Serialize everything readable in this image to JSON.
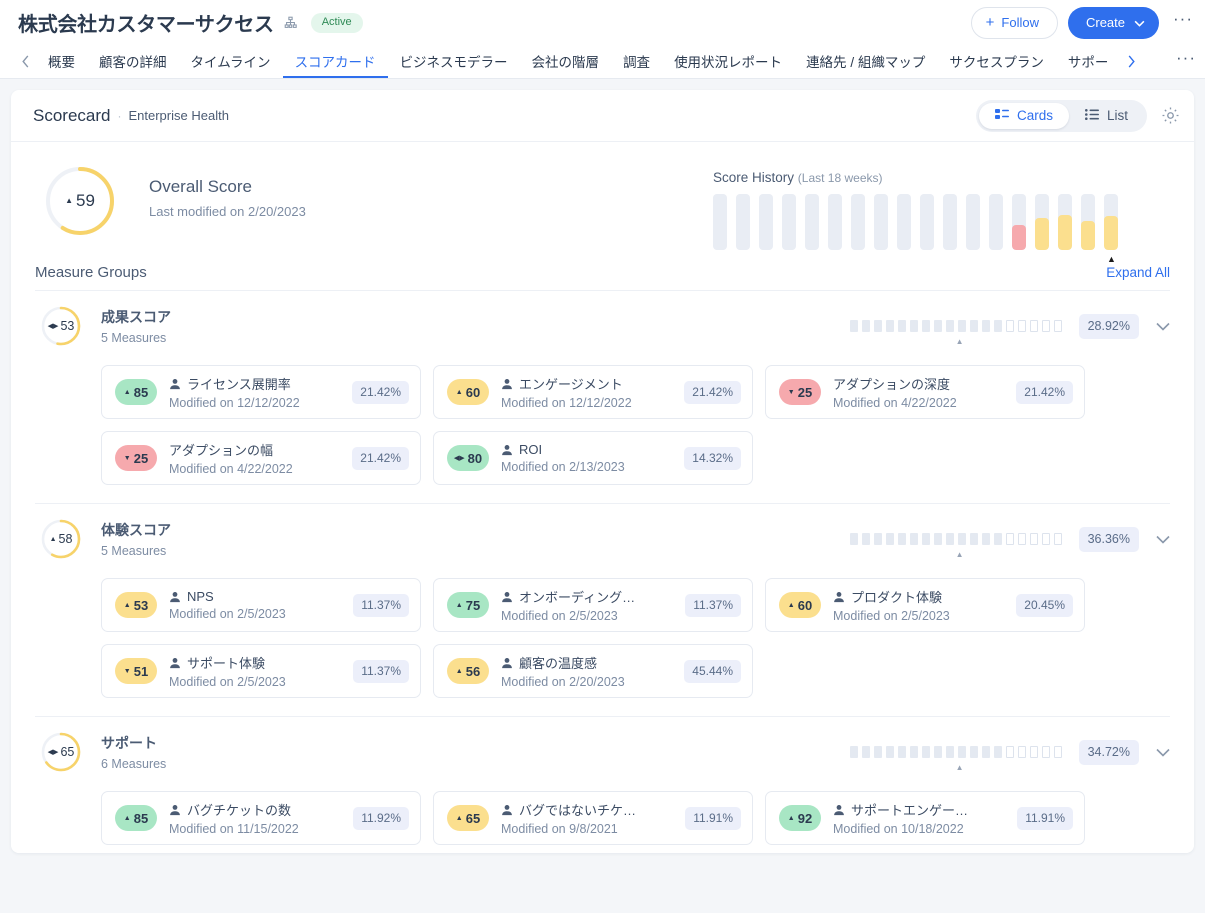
{
  "header": {
    "company_title": "株式会社カスタマーサクセス",
    "hierarchy_icon": "org-hierarchy-icon",
    "status": "Active",
    "follow_label": "Follow",
    "follow_icon": "plus-icon",
    "create_label": "Create",
    "create_icon": "chevron-down-icon",
    "overflow_icon": "ellipsis-icon"
  },
  "tabs": {
    "prev_icon": "chevron-left-icon",
    "next_icon": "chevron-right-icon",
    "more_icon": "ellipsis-icon",
    "items": [
      {
        "label": "概要",
        "active": false
      },
      {
        "label": "顧客の詳細",
        "active": false
      },
      {
        "label": "タイムライン",
        "active": false
      },
      {
        "label": "スコアカード",
        "active": true
      },
      {
        "label": "ビジネスモデラー",
        "active": false
      },
      {
        "label": "会社の階層",
        "active": false
      },
      {
        "label": "調査",
        "active": false
      },
      {
        "label": "使用状況レポート",
        "active": false
      },
      {
        "label": "連絡先 / 組織マップ",
        "active": false
      },
      {
        "label": "サクセスプラン",
        "active": false
      },
      {
        "label": "サポー",
        "active": false
      }
    ]
  },
  "panel": {
    "title": "Scorecard",
    "separator": "·",
    "subtitle": "Enterprise Health",
    "view_cards_label": "Cards",
    "view_cards_icon": "cards-view-icon",
    "view_list_label": "List",
    "view_list_icon": "list-view-icon",
    "settings_icon": "gear-icon",
    "active_view": "Cards"
  },
  "overall": {
    "score": "59",
    "trend": "up",
    "trend_icon": "triangle-up-icon",
    "ring_percent": 59,
    "ring_color": "#f7d36a",
    "title": "Overall Score",
    "subtitle": "Last modified on 2/20/2023"
  },
  "score_history": {
    "label": "Score History",
    "range": "(Last 18 weeks)",
    "marker_icon": "triangle-up-marker",
    "marker_index": 17,
    "bars": [
      {
        "fill_pct": 0,
        "color": ""
      },
      {
        "fill_pct": 0,
        "color": ""
      },
      {
        "fill_pct": 0,
        "color": ""
      },
      {
        "fill_pct": 0,
        "color": ""
      },
      {
        "fill_pct": 0,
        "color": ""
      },
      {
        "fill_pct": 0,
        "color": ""
      },
      {
        "fill_pct": 0,
        "color": ""
      },
      {
        "fill_pct": 0,
        "color": ""
      },
      {
        "fill_pct": 0,
        "color": ""
      },
      {
        "fill_pct": 0,
        "color": ""
      },
      {
        "fill_pct": 0,
        "color": ""
      },
      {
        "fill_pct": 0,
        "color": ""
      },
      {
        "fill_pct": 0,
        "color": ""
      },
      {
        "fill_pct": 45,
        "color": "#f6a9ad"
      },
      {
        "fill_pct": 58,
        "color": "#fbdf8e"
      },
      {
        "fill_pct": 62,
        "color": "#fbdf8e"
      },
      {
        "fill_pct": 52,
        "color": "#fbdf8e"
      },
      {
        "fill_pct": 60,
        "color": "#fbdf8e"
      }
    ]
  },
  "measure_groups": {
    "heading": "Measure Groups",
    "expand_all": "Expand All",
    "chevron_icon": "chevron-down-icon",
    "square_total": 18,
    "groups": [
      {
        "score": "53",
        "trend_icon": "diamond-flat-icon",
        "ring_percent": 53,
        "ring_color": "#f7d36a",
        "name": "成果スコア",
        "count": "5 Measures",
        "percent": "28.92%",
        "squares_filled": 13,
        "measures": [
          {
            "score": "85",
            "trend_icon": "triangle-up-icon",
            "pill": "p-green",
            "person_icon": true,
            "name": "ライセンス展開率",
            "modified": "Modified on 12/12/2022",
            "percent": "21.42%"
          },
          {
            "score": "60",
            "trend_icon": "triangle-up-icon",
            "pill": "p-yellow",
            "person_icon": true,
            "name": "エンゲージメント",
            "modified": "Modified on 12/12/2022",
            "percent": "21.42%"
          },
          {
            "score": "25",
            "trend_icon": "triangle-down-icon",
            "pill": "p-red",
            "person_icon": false,
            "name": "アダプションの深度",
            "modified": "Modified on 4/22/2022",
            "percent": "21.42%"
          },
          {
            "score": "25",
            "trend_icon": "triangle-down-icon",
            "pill": "p-red",
            "person_icon": false,
            "name": "アダプションの幅",
            "modified": "Modified on 4/22/2022",
            "percent": "21.42%"
          },
          {
            "score": "80",
            "trend_icon": "diamond-flat-icon",
            "pill": "p-green",
            "person_icon": true,
            "name": "ROI",
            "modified": "Modified on 2/13/2023",
            "percent": "14.32%"
          }
        ]
      },
      {
        "score": "58",
        "trend_icon": "triangle-up-icon",
        "ring_percent": 58,
        "ring_color": "#f7d36a",
        "name": "体験スコア",
        "count": "5 Measures",
        "percent": "36.36%",
        "squares_filled": 13,
        "measures": [
          {
            "score": "53",
            "trend_icon": "triangle-up-icon",
            "pill": "p-yellow",
            "person_icon": true,
            "name": "NPS",
            "modified": "Modified on 2/5/2023",
            "percent": "11.37%"
          },
          {
            "score": "75",
            "trend_icon": "triangle-up-icon",
            "pill": "p-green",
            "person_icon": true,
            "name": "オンボーディング…",
            "modified": "Modified on 2/5/2023",
            "percent": "11.37%"
          },
          {
            "score": "60",
            "trend_icon": "triangle-up-icon",
            "pill": "p-yellow",
            "person_icon": true,
            "name": "プロダクト体験",
            "modified": "Modified on 2/5/2023",
            "percent": "20.45%"
          },
          {
            "score": "51",
            "trend_icon": "triangle-down-icon",
            "pill": "p-yellow",
            "person_icon": true,
            "name": "サポート体験",
            "modified": "Modified on 2/5/2023",
            "percent": "11.37%"
          },
          {
            "score": "56",
            "trend_icon": "triangle-up-icon",
            "pill": "p-yellow",
            "person_icon": true,
            "name": "顧客の温度感",
            "modified": "Modified on 2/20/2023",
            "percent": "45.44%"
          }
        ]
      },
      {
        "score": "65",
        "trend_icon": "diamond-flat-icon",
        "ring_percent": 65,
        "ring_color": "#f7d36a",
        "name": "サポート",
        "count": "6 Measures",
        "percent": "34.72%",
        "squares_filled": 13,
        "measures": [
          {
            "score": "85",
            "trend_icon": "triangle-up-icon",
            "pill": "p-green",
            "person_icon": true,
            "name": "バグチケットの数",
            "modified": "Modified on 11/15/2022",
            "percent": "11.92%"
          },
          {
            "score": "65",
            "trend_icon": "triangle-up-icon",
            "pill": "p-yellow",
            "person_icon": true,
            "name": "バグではないチケ…",
            "modified": "Modified on 9/8/2021",
            "percent": "11.91%"
          },
          {
            "score": "92",
            "trend_icon": "triangle-up-icon",
            "pill": "p-green",
            "person_icon": true,
            "name": "サポートエンゲー…",
            "modified": "Modified on 10/18/2022",
            "percent": "11.91%"
          }
        ]
      }
    ]
  }
}
